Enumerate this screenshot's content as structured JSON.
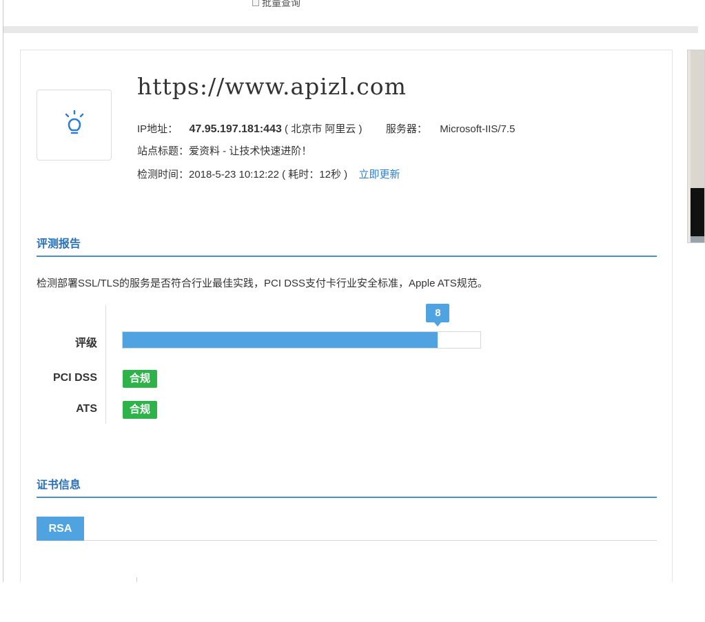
{
  "top": {
    "batch_query_label": "批量查询"
  },
  "site": {
    "url": "https://www.apizl.com",
    "ip_label": "IP地址：",
    "ip_value": "47.95.197.181:443",
    "location": "( 北京市 阿里云 )",
    "server_label": "服务器：",
    "server_value": "Microsoft-IIS/7.5",
    "title_line": "站点标题：爱资料 - 让技术快速进阶！",
    "check_time_line": "检测时间：2018-5-23 10:12:22 ( 耗时：12秒 )",
    "refresh_link": "立即更新",
    "icon": "lightbulb-icon"
  },
  "report": {
    "section_title": "评测报告",
    "description": "检测部署SSL/TLS的服务是否符合行业最佳实践，PCI DSS支付卡行业安全标准，Apple ATS规范。",
    "grade_label": "评级",
    "grade_score": "8",
    "grade_fraction": 0.88,
    "pci_label": "PCI DSS",
    "pci_status": "合规",
    "ats_label": "ATS",
    "ats_status": "合规"
  },
  "cert": {
    "section_title": "证书信息",
    "tab_rsa": "RSA"
  },
  "colors": {
    "accent": "#4fa3e0",
    "section_title": "#2a6fb5",
    "compliant": "#2db34a",
    "link": "#2a7fd4"
  }
}
